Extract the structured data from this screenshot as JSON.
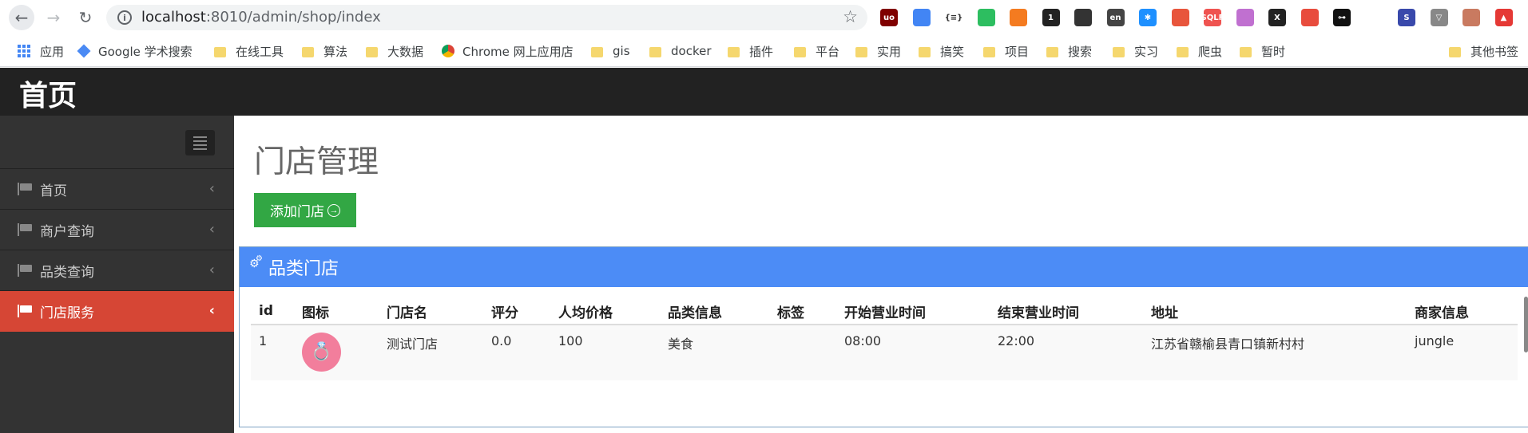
{
  "browser": {
    "url_host": "localhost",
    "url_path": ":8010/admin/shop/index",
    "extensions": [
      {
        "icon": "ublock-icon",
        "color": "#800000",
        "text": "uo"
      },
      {
        "icon": "chrome-color-icon",
        "color": "#4285f4",
        "text": ""
      },
      {
        "icon": "json-icon",
        "color": "#ffffff",
        "text": "{≡}"
      },
      {
        "icon": "evernote-icon",
        "color": "#2dbe60",
        "text": ""
      },
      {
        "icon": "orange-ext-icon",
        "color": "#f47b20",
        "text": ""
      },
      {
        "icon": "badge-ext-icon",
        "color": "#222222",
        "text": "1"
      },
      {
        "icon": "mask-icon",
        "color": "#333333",
        "text": ""
      },
      {
        "icon": "translate-icon",
        "color": "#444444",
        "text": "en"
      },
      {
        "icon": "asterisk-icon",
        "color": "#1e90ff",
        "text": "✱"
      },
      {
        "icon": "tree-icon",
        "color": "#e8553c",
        "text": ""
      },
      {
        "icon": "sqlf-icon",
        "color": "#ef5350",
        "text": "SQLF"
      },
      {
        "icon": "purple-ext-icon",
        "color": "#c070d0",
        "text": ""
      },
      {
        "icon": "x-ext-icon",
        "color": "#222222",
        "text": "X"
      },
      {
        "icon": "location-icon",
        "color": "#e84c3d",
        "text": ""
      },
      {
        "icon": "key-icon",
        "color": "#111111",
        "text": "⊶"
      },
      {
        "icon": "cursor-icon",
        "color": "#ffffff",
        "text": ""
      },
      {
        "icon": "s-ext-icon",
        "color": "#3949ab",
        "text": "S"
      },
      {
        "icon": "vue-icon",
        "color": "#888888",
        "text": "▽"
      },
      {
        "icon": "avatar-ext-icon",
        "color": "#c97a60",
        "text": ""
      },
      {
        "icon": "update-icon",
        "color": "#e53935",
        "text": "▲"
      }
    ],
    "bookmarks": [
      {
        "label": "应用",
        "type": "apps"
      },
      {
        "label": "Google 学术搜索",
        "type": "google"
      },
      {
        "label": "在线工具",
        "type": "folder"
      },
      {
        "label": "算法",
        "type": "folder"
      },
      {
        "label": "大数据",
        "type": "folder"
      },
      {
        "label": "Chrome 网上应用店",
        "type": "chrome"
      },
      {
        "label": "gis",
        "type": "folder"
      },
      {
        "label": "docker",
        "type": "folder"
      },
      {
        "label": "插件",
        "type": "folder"
      },
      {
        "label": "平台",
        "type": "folder"
      },
      {
        "label": "实用",
        "type": "folder"
      },
      {
        "label": "搞笑",
        "type": "folder"
      },
      {
        "label": "项目",
        "type": "folder"
      },
      {
        "label": "搜索",
        "type": "folder"
      },
      {
        "label": "实习",
        "type": "folder"
      },
      {
        "label": "爬虫",
        "type": "folder"
      },
      {
        "label": "暂时",
        "type": "folder"
      }
    ],
    "other_bookmarks": "其他书签"
  },
  "header": {
    "brand": "首页"
  },
  "sidebar": {
    "items": [
      {
        "label": "首页",
        "active": false
      },
      {
        "label": "商户查询",
        "active": false
      },
      {
        "label": "品类查询",
        "active": false
      },
      {
        "label": "门店服务",
        "active": true
      }
    ]
  },
  "main": {
    "title": "门店管理",
    "add_button": "添加门店",
    "portlet_title": "品类门店",
    "columns": [
      "id",
      "图标",
      "门店名",
      "评分",
      "人均价格",
      "品类信息",
      "标签",
      "开始营业时间",
      "结束营业时间",
      "地址",
      "商家信息"
    ],
    "rows": [
      {
        "id": "1",
        "icon": "ring-icon",
        "name": "测试门店",
        "score": "0.0",
        "price": "100",
        "category": "美食",
        "tags": "",
        "start": "08:00",
        "end": "22:00",
        "address": "江苏省赣榆县青口镇新村村",
        "seller": "jungle"
      }
    ]
  }
}
